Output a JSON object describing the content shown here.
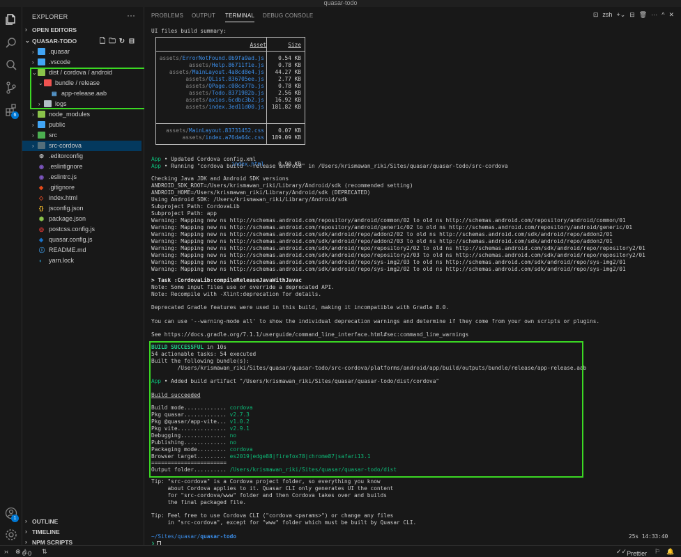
{
  "window": {
    "title": "quasar-todo"
  },
  "activity": {
    "extensions_badge": "6",
    "accounts_badge": "1"
  },
  "explorer": {
    "title": "EXPLORER",
    "open_editors": "OPEN EDITORS",
    "project": "QUASAR-TODO",
    "items": [
      {
        "name": ".quasar",
        "kind": "folder"
      },
      {
        "name": ".vscode",
        "kind": "folder"
      },
      {
        "name": "dist / cordova / android",
        "kind": "folder-open"
      },
      {
        "name": "bundle / release",
        "kind": "folder-open"
      },
      {
        "name": "app-release.aab",
        "kind": "file"
      },
      {
        "name": "logs",
        "kind": "folder"
      },
      {
        "name": "node_modules",
        "kind": "folder"
      },
      {
        "name": "public",
        "kind": "folder"
      },
      {
        "name": "src",
        "kind": "folder"
      },
      {
        "name": "src-cordova",
        "kind": "folder"
      },
      {
        "name": ".editorconfig",
        "kind": "file"
      },
      {
        "name": ".eslintignore",
        "kind": "file"
      },
      {
        "name": ".eslintrc.js",
        "kind": "file"
      },
      {
        "name": ".gitignore",
        "kind": "file"
      },
      {
        "name": "index.html",
        "kind": "file"
      },
      {
        "name": "jsconfig.json",
        "kind": "file"
      },
      {
        "name": "package.json",
        "kind": "file"
      },
      {
        "name": "postcss.config.js",
        "kind": "file"
      },
      {
        "name": "quasar.config.js",
        "kind": "file"
      },
      {
        "name": "README.md",
        "kind": "file"
      },
      {
        "name": "yarn.lock",
        "kind": "file"
      }
    ],
    "outline": "OUTLINE",
    "timeline": "TIMELINE",
    "npm_scripts": "NPM SCRIPTS"
  },
  "panel": {
    "tabs": [
      "PROBLEMS",
      "OUTPUT",
      "TERMINAL",
      "DEBUG CONSOLE"
    ],
    "active_tab": "TERMINAL",
    "shell": "zsh"
  },
  "terminal": {
    "summary_title": "UI files build summary:",
    "table_header": {
      "asset": "Asset",
      "size": "Size"
    },
    "js_assets": [
      {
        "dir": "assets/",
        "file": "ErrorNotFound.0b9fa9ad.js",
        "size": "0.54 KB"
      },
      {
        "dir": "assets/",
        "file": "Help.86711f1e.js",
        "size": "0.78 KB"
      },
      {
        "dir": "assets/",
        "file": "MainLayout.4a8cd8e4.js",
        "size": "44.27 KB"
      },
      {
        "dir": "assets/",
        "file": "QList.836705ee.js",
        "size": "2.77 KB"
      },
      {
        "dir": "assets/",
        "file": "QPage.c08ce77b.js",
        "size": "0.78 KB"
      },
      {
        "dir": "assets/",
        "file": "Todo.8371982b.js",
        "size": "2.56 KB"
      },
      {
        "dir": "assets/",
        "file": "axios.6cdbc3b2.js",
        "size": "16.92 KB"
      },
      {
        "dir": "assets/",
        "file": "index.3ed11d00.js",
        "size": "181.82 KB"
      }
    ],
    "css_assets": [
      {
        "dir": "assets/",
        "file": "MainLayout.83731452.css",
        "size": "0.07 KB"
      },
      {
        "dir": "assets/",
        "file": "index.a76da64c.css",
        "size": "189.09 KB"
      }
    ],
    "html_assets": [
      {
        "dir": "",
        "file": "index.html",
        "size": "0.90 KB"
      }
    ],
    "app_updated": " • Updated Cordova config.xml",
    "app_running": " • Running \"cordova build --release android\" in /Users/krismawan_riki/Sites/quasar/quasar-todo/src-cordova",
    "app_label": "App",
    "lines_a": [
      "Checking Java JDK and Android SDK versions",
      "ANDROID_SDK_ROOT=/Users/krismawan_riki/Library/Android/sdk (recommended setting)",
      "ANDROID_HOME=/Users/krismawan_riki/Library/Android/sdk (DEPRECATED)",
      "Using Android SDK: /Users/krismawan_riki/Library/Android/sdk",
      "Subproject Path: CordovaLib",
      "Subproject Path: app",
      "Warning: Mapping new ns http://schemas.android.com/repository/android/common/02 to old ns http://schemas.android.com/repository/android/common/01",
      "Warning: Mapping new ns http://schemas.android.com/repository/android/generic/02 to old ns http://schemas.android.com/repository/android/generic/01",
      "Warning: Mapping new ns http://schemas.android.com/sdk/android/repo/addon2/02 to old ns http://schemas.android.com/sdk/android/repo/addon2/01",
      "Warning: Mapping new ns http://schemas.android.com/sdk/android/repo/addon2/03 to old ns http://schemas.android.com/sdk/android/repo/addon2/01",
      "Warning: Mapping new ns http://schemas.android.com/sdk/android/repo/repository2/02 to old ns http://schemas.android.com/sdk/android/repo/repository2/01",
      "Warning: Mapping new ns http://schemas.android.com/sdk/android/repo/repository2/03 to old ns http://schemas.android.com/sdk/android/repo/repository2/01",
      "Warning: Mapping new ns http://schemas.android.com/sdk/android/repo/sys-img2/03 to old ns http://schemas.android.com/sdk/android/repo/sys-img2/01",
      "Warning: Mapping new ns http://schemas.android.com/sdk/android/repo/sys-img2/02 to old ns http://schemas.android.com/sdk/android/repo/sys-img2/01"
    ],
    "task_line": "> Task :CordovaLib:compileReleaseJavaWithJavac",
    "note1": "Note: Some input files use or override a deprecated API.",
    "note2": "Note: Recompile with -Xlint:deprecation for details.",
    "deprecated": "Deprecated Gradle features were used in this build, making it incompatible with Gradle 8.0.",
    "warning_mode": "You can use '--warning-mode all' to show the individual deprecation warnings and determine if they come from your own scripts or plugins.",
    "see_docs": "See https://docs.gradle.org/7.1.1/userguide/command_line_interface.html#sec:command_line_warnings",
    "build_successful": "BUILD SUCCESSFUL",
    "build_time": " in 10s",
    "tasks": "54 actionable tasks: 54 executed",
    "built_bundles": "Built the following bundle(s):",
    "bundle_path": "        /Users/krismawan_riki/Sites/quasar/quasar-todo/src-cordova/platforms/android/app/build/outputs/bundle/release/app-release.aab",
    "added_artifact": " • Added build artifact \"/Users/krismawan_riki/Sites/quasar/quasar-todo/dist/cordova\"",
    "build_succeeded": "Build succeeded",
    "details": [
      {
        "label": "Build mode............. ",
        "value": "cordova"
      },
      {
        "label": "Pkg quasar............. ",
        "value": "v2.7.3"
      },
      {
        "label": "Pkg @quasar/app-vite... ",
        "value": "v1.0.2"
      },
      {
        "label": "Pkg vite............... ",
        "value": "v2.9.1"
      },
      {
        "label": "Debugging.............. ",
        "value": "no"
      },
      {
        "label": "Publishing............. ",
        "value": "no"
      },
      {
        "label": "Packaging mode......... ",
        "value": "cordova"
      },
      {
        "label": "Browser target......... ",
        "value": "es2019|edge88|firefox78|chrome87|safari13.1"
      }
    ],
    "separator": "=======================",
    "output_label": "Output folder.......... ",
    "output_value": "/Users/krismawan_riki/Sites/quasar/quasar-todo/dist",
    "tip1": [
      "Tip: \"src-cordova\" is a Cordova project folder, so everything you know",
      "     about Cordova applies to it. Quasar CLI only generates UI the content",
      "     for \"src-cordova/www\" folder and then Cordova takes over and builds",
      "     the final packaged file."
    ],
    "tip2": [
      "Tip: Feel free to use Cordova CLI (\"cordova <params>\") or change any files",
      "     in \"src-cordova\", except for \"www\" folder which must be built by Quasar CLI."
    ],
    "prompt_path": "~/Sites/quasar/",
    "prompt_dir": "quasar-todo",
    "prompt_time": "25s 14:33:40",
    "prompt_symbol": "❯"
  },
  "status": {
    "errors": "0",
    "warnings": "0",
    "prettier": "Prettier"
  }
}
